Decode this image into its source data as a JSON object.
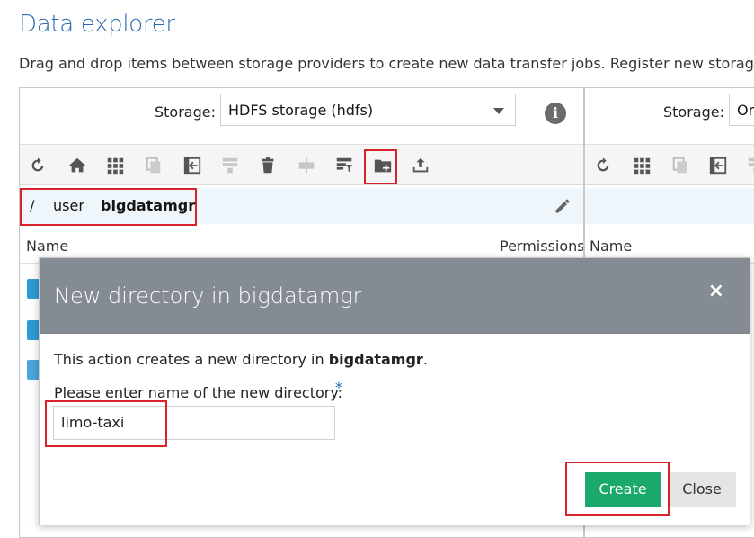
{
  "page": {
    "title": "Data explorer",
    "subtitle": "Drag and drop items between storage providers to create new data transfer jobs. Register new storage pro"
  },
  "left_panel": {
    "storage_label": "Storage:",
    "storage_value": "HDFS storage (hdfs)",
    "info_icon": "i",
    "toolbar": [
      "refresh-icon",
      "home-icon",
      "grid-view-icon",
      "copy-icon",
      "move-icon",
      "merge-icon",
      "delete-icon",
      "split-icon",
      "filter-icon",
      "new-folder-icon",
      "upload-icon"
    ],
    "breadcrumb": {
      "root": "/",
      "part1": "user",
      "current": "bigdatamgr"
    },
    "columns": {
      "name": "Name",
      "permissions": "Permissions"
    }
  },
  "right_panel": {
    "storage_label": "Storage:",
    "storage_value": "Ora",
    "columns": {
      "name": "Name"
    },
    "toolbar": [
      "refresh-icon",
      "grid-view-icon",
      "copy-icon",
      "move-icon",
      "merge-icon"
    ]
  },
  "modal": {
    "title": "New directory in bigdatamgr",
    "close_symbol": "×",
    "text_prefix": "This action creates a new directory in ",
    "text_bold": "bigdatamgr",
    "text_suffix": ".",
    "field_label": "Please enter name of the new directory:",
    "required_mark": "*",
    "field_value": "limo-taxi",
    "create_label": "Create",
    "close_label": "Close"
  },
  "colors": {
    "accent": "#2a6bb0",
    "create_button": "#1ba86b",
    "modal_header": "#858b93",
    "highlight": "#d8232a"
  }
}
